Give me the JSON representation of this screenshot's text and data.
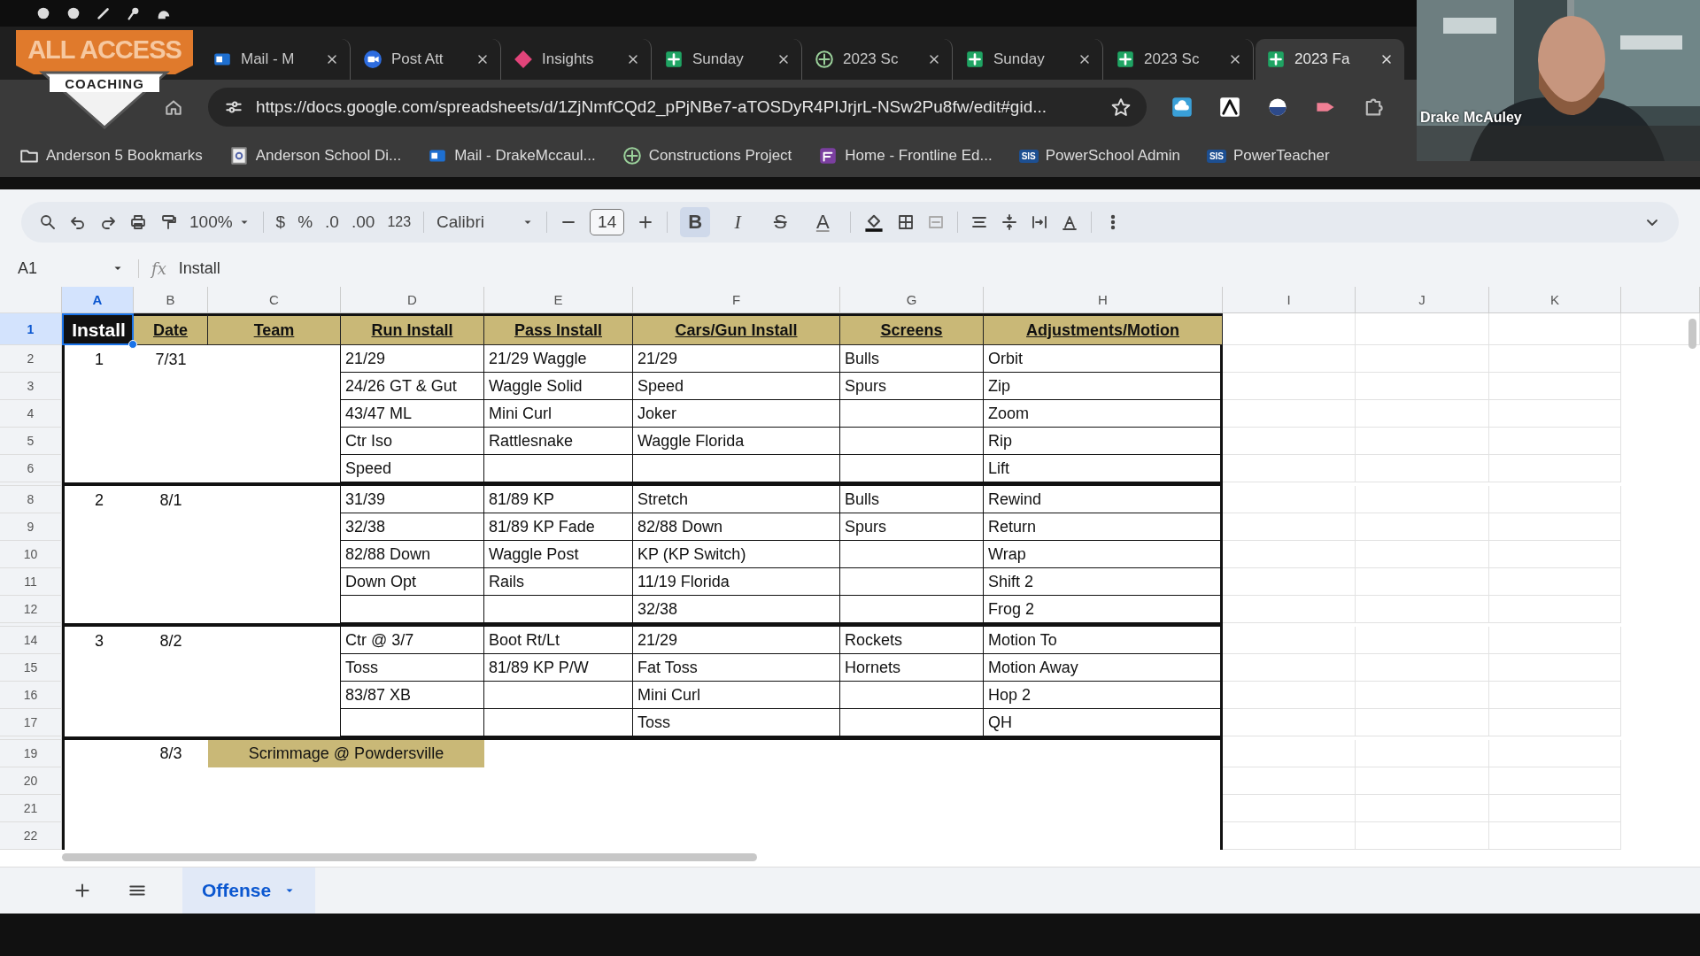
{
  "overlay_icons": [
    {
      "kind": "ball"
    },
    {
      "kind": "ball"
    },
    {
      "kind": "bat"
    },
    {
      "kind": "mic"
    },
    {
      "kind": "helmet"
    }
  ],
  "logo": {
    "title": "ALL ACCESS",
    "subtitle": "COACHING"
  },
  "video": {
    "kind": "picture",
    "name": "Drake McAuley"
  },
  "browser": {
    "tabs": [
      {
        "title": "Mail - M",
        "kind": "mail",
        "selected": false
      },
      {
        "title": "Post Att",
        "kind": "video",
        "selected": false
      },
      {
        "title": "Insights",
        "kind": "diamond",
        "selected": false
      },
      {
        "title": "Sunday",
        "kind": "sheet",
        "selected": false
      },
      {
        "title": "2023 Sc",
        "kind": "globe",
        "selected": false
      },
      {
        "title": "Sunday",
        "kind": "sheet",
        "selected": false
      },
      {
        "title": "2023 Sc",
        "kind": "sheet",
        "selected": false
      },
      {
        "title": "2023 Fa",
        "kind": "sheet",
        "selected": true
      }
    ],
    "url": "https://docs.google.com/spreadsheets/d/1ZjNmfCQd2_pPjNBe7-aTOSDyR4PIJrjrL-NSw2Pu8fw/edit#gid...",
    "bookmarks": [
      {
        "label": "Anderson 5 Bookmarks",
        "kind": "folder"
      },
      {
        "label": "Anderson School Di...",
        "kind": "page"
      },
      {
        "label": "Mail - DrakeMccaul...",
        "kind": "mail"
      },
      {
        "label": "Constructions Project",
        "kind": "globe"
      },
      {
        "label": "Home - Frontline Ed...",
        "kind": "swirl"
      },
      {
        "label": "PowerSchool Admin",
        "kind": "badge",
        "badge": "SIS"
      },
      {
        "label": "PowerTeacher",
        "kind": "badge",
        "badge": "SIS"
      }
    ]
  },
  "toolbar": {
    "zoom": "100%",
    "currency": "$",
    "percent": "%",
    "decrease_decimal": ".0",
    "increase_decimal": ".00",
    "number_format": "123",
    "font": "Calibri",
    "font_size": "14",
    "format_buttons": [
      {
        "label": "B",
        "kind": "bold",
        "on": true
      },
      {
        "label": "I",
        "kind": "italic",
        "on": false
      },
      {
        "label": "S",
        "kind": "strike",
        "on": false
      },
      {
        "label": "A",
        "kind": "color",
        "on": false
      }
    ]
  },
  "formula_bar": {
    "cell": "A1",
    "fx": "fx",
    "content": "Install"
  },
  "columns": [
    {
      "label": "A",
      "selected": true
    },
    {
      "label": "B",
      "selected": false
    },
    {
      "label": "C",
      "selected": false
    },
    {
      "label": "D",
      "selected": false
    },
    {
      "label": "E",
      "selected": false
    },
    {
      "label": "F",
      "selected": false
    },
    {
      "label": "G",
      "selected": false
    },
    {
      "label": "H",
      "selected": false
    },
    {
      "label": "I",
      "selected": false
    },
    {
      "label": "J",
      "selected": false
    },
    {
      "label": "K",
      "selected": false
    }
  ],
  "header": {
    "row": "1",
    "cells": [
      {
        "text": "Install",
        "selected": true
      },
      {
        "text": "Date",
        "selected": false
      },
      {
        "text": "Team",
        "selected": false
      },
      {
        "text": "Run Install",
        "selected": false
      },
      {
        "text": "Pass Install",
        "selected": false
      },
      {
        "text": "Cars/Gun Install",
        "selected": false
      },
      {
        "text": "Screens",
        "selected": false
      },
      {
        "text": "Adjustments/Motion",
        "selected": false
      }
    ]
  },
  "groups": [
    {
      "install": "1",
      "date": "7/31",
      "rows": [
        {
          "row": "2",
          "run_install": "21/29",
          "pass_install": "21/29 Waggle",
          "cars_gun_install": "21/29",
          "screens": "Bulls",
          "adjustments_motion": "Orbit"
        },
        {
          "row": "3",
          "run_install": "24/26 GT & Gut",
          "pass_install": "Waggle Solid",
          "cars_gun_install": "Speed",
          "screens": "Spurs",
          "adjustments_motion": "Zip"
        },
        {
          "row": "4",
          "run_install": "43/47 ML",
          "pass_install": "Mini Curl",
          "cars_gun_install": "Joker",
          "adjustments_motion": "Zoom"
        },
        {
          "row": "5",
          "run_install": "Ctr Iso",
          "pass_install": "Rattlesnake",
          "cars_gun_install": "Waggle Florida",
          "adjustments_motion": "Rip"
        },
        {
          "row": "6",
          "run_install": "Speed",
          "adjustments_motion": "Lift"
        }
      ]
    },
    {
      "install": "2",
      "date": "8/1",
      "rows": [
        {
          "row": "8",
          "run_install": "31/39",
          "pass_install": "81/89 KP",
          "cars_gun_install": "Stretch",
          "screens": "Bulls",
          "adjustments_motion": "Rewind"
        },
        {
          "row": "9",
          "run_install": "32/38",
          "pass_install": "81/89 KP Fade",
          "cars_gun_install": "82/88 Down",
          "screens": "Spurs",
          "adjustments_motion": "Return"
        },
        {
          "row": "10",
          "run_install": "82/88 Down",
          "pass_install": "Waggle Post",
          "cars_gun_install": "KP (KP Switch)",
          "adjustments_motion": "Wrap"
        },
        {
          "row": "11",
          "run_install": "Down Opt",
          "pass_install": "Rails",
          "cars_gun_install": "11/19 Florida",
          "adjustments_motion": "Shift 2"
        },
        {
          "row": "12",
          "cars_gun_install": "32/38",
          "adjustments_motion": "Frog 2"
        }
      ]
    },
    {
      "install": "3",
      "date": "8/2",
      "rows": [
        {
          "row": "14",
          "run_install": "Ctr @ 3/7",
          "pass_install": "Boot Rt/Lt",
          "cars_gun_install": "21/29",
          "screens": "Rockets",
          "adjustments_motion": "Motion To"
        },
        {
          "row": "15",
          "run_install": "Toss",
          "pass_install": "81/89 KP P/W",
          "cars_gun_install": "Fat Toss",
          "screens": "Hornets",
          "adjustments_motion": "Motion Away"
        },
        {
          "row": "16",
          "run_install": "83/87 XB",
          "cars_gun_install": "Mini Curl",
          "adjustments_motion": "Hop 2"
        },
        {
          "row": "17",
          "cars_gun_install": "Toss",
          "adjustments_motion": "QH"
        }
      ]
    }
  ],
  "scrimmage": {
    "row": "19",
    "date": "8/3",
    "label": "Scrimmage @ Powdersville"
  },
  "empty_rows": [
    "20",
    "21",
    "22"
  ],
  "sheet_tabs": [
    {
      "label": "Offense",
      "selected": true
    }
  ]
}
